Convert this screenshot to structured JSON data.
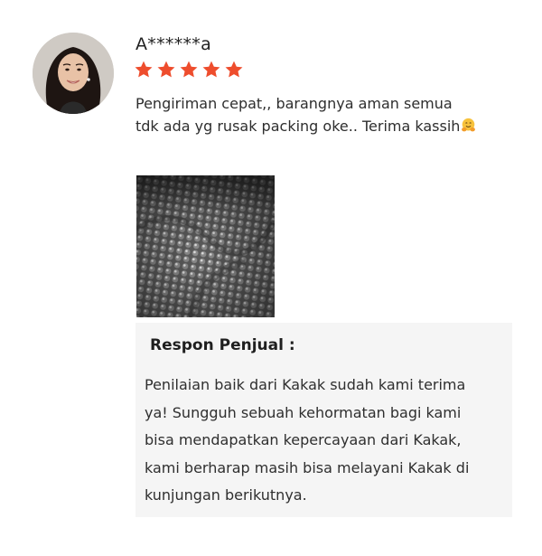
{
  "review": {
    "reviewer_name": "A******a",
    "rating": 5,
    "rating_max": 5,
    "star_color": "#ee4d2d",
    "text_lines": [
      "Pengiriman cepat,, barangnya aman semua",
      "tdk ada yg rusak packing oke.. Terima kassih"
    ],
    "emoji": "hugging-face-icon"
  },
  "seller_response": {
    "title": "Respon Penjual :",
    "text_lines": [
      "Penilaian baik dari Kakak sudah kami terima",
      "ya! Sungguh sebuah kehormatan bagi kami",
      "bisa mendapatkan kepercayaan dari Kakak,",
      "kami berharap masih bisa melayani Kakak di",
      "kunjungan berikutnya."
    ]
  },
  "colors": {
    "response_bg": "#f5f5f5",
    "text": "#2e2e2e"
  }
}
